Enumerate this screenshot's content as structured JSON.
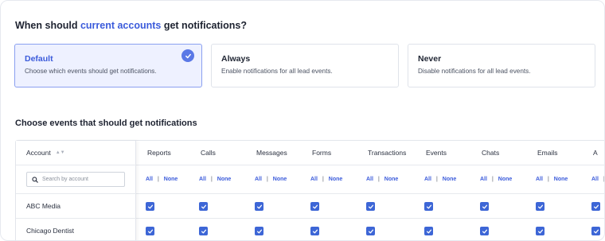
{
  "header": {
    "prefix": "When should ",
    "highlight": "current accounts",
    "suffix": " get notifications?"
  },
  "options": [
    {
      "title": "Default",
      "desc": "Choose which events should get notifications.",
      "selected": true
    },
    {
      "title": "Always",
      "desc": "Enable notifications for all lead events.",
      "selected": false
    },
    {
      "title": "Never",
      "desc": "Disable notifications for all lead events.",
      "selected": false
    }
  ],
  "events_heading": "Choose events that should get notifications",
  "table": {
    "account_header": "Account",
    "search_placeholder": "Search by account",
    "all_label": "All",
    "separator": "|",
    "none_label": "None",
    "columns": [
      "Reports",
      "Calls",
      "Messages",
      "Forms",
      "Transactions",
      "Events",
      "Chats",
      "Emails",
      "A"
    ],
    "rows": [
      {
        "account": "ABC Media",
        "checked": [
          true,
          true,
          true,
          true,
          true,
          true,
          true,
          true,
          true
        ]
      },
      {
        "account": "Chicago Dentist",
        "checked": [
          true,
          true,
          true,
          true,
          true,
          true,
          true,
          true,
          true
        ]
      }
    ]
  },
  "colors": {
    "accent": "#3b5bdb",
    "checkbox": "#3d66d6",
    "selected_bg": "#eef1ff"
  },
  "icons": {
    "selected": "check-circle-icon",
    "search": "search-icon",
    "sort": "sort-icon",
    "checkbox": "checkbox-checked-icon"
  }
}
